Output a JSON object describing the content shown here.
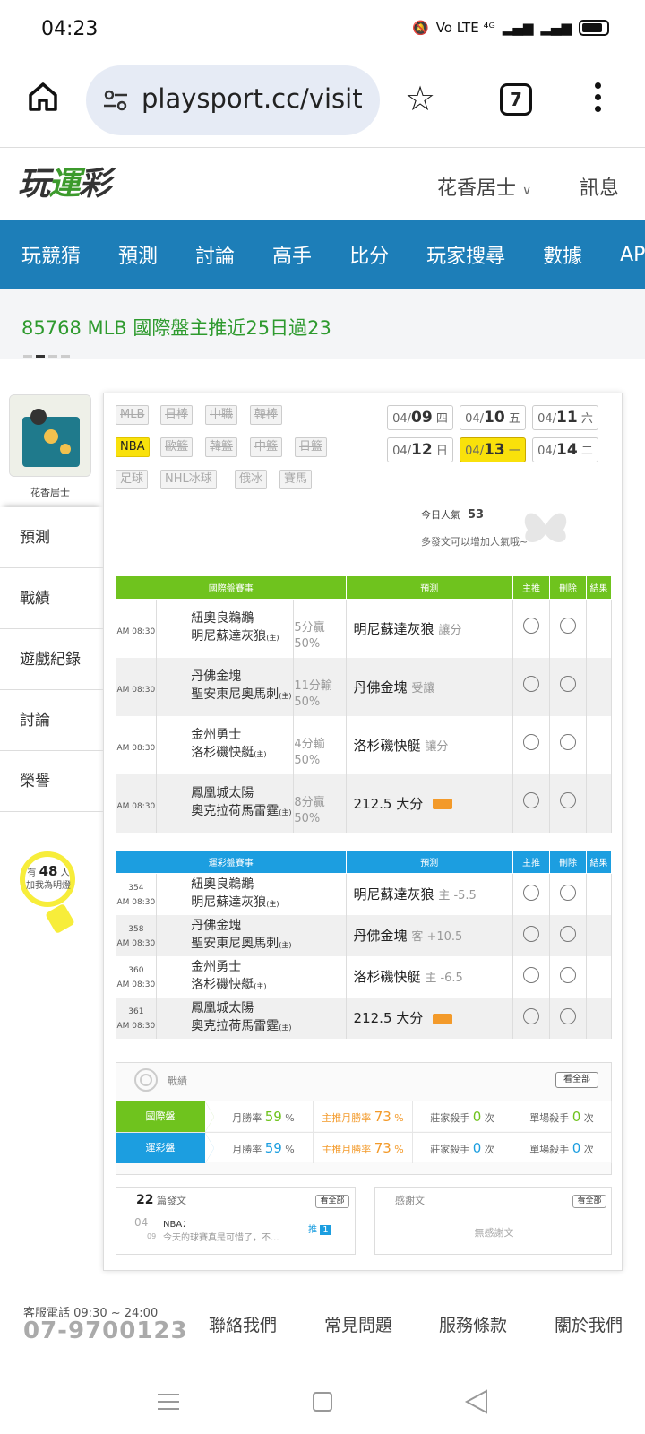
{
  "status_bar": {
    "time": "04:23",
    "icons_text": "Vo LTE ⁴ᴳ"
  },
  "browser": {
    "url": "playsport.cc/visit",
    "tab_count": "7"
  },
  "header": {
    "logo": "玩運彩",
    "user": "花香居士",
    "message": "訊息"
  },
  "nav": [
    "玩競猜",
    "預測",
    "討論",
    "高手",
    "比分",
    "玩家搜尋",
    "數據",
    "APP"
  ],
  "headline": "85768 MLB 國際盤主推近25日過23",
  "profile": {
    "name": "花香居士"
  },
  "sidebar": [
    {
      "label": "預測"
    },
    {
      "label": "戰績"
    },
    {
      "label": "遊戲紀錄"
    },
    {
      "label": "討論"
    },
    {
      "label": "榮譽"
    }
  ],
  "bulb": {
    "prefix": "有",
    "count": "48",
    "suffix": "人",
    "text": "加我為明燈"
  },
  "league_tags": [
    [
      "MLB",
      "日棒",
      "中職",
      "韓棒"
    ],
    [
      "NBA",
      "歐籃",
      "韓籃",
      "中籃",
      "日籃"
    ],
    [
      "足球",
      "NHL冰球",
      "俄冰",
      "賽馬"
    ]
  ],
  "active_league": "NBA",
  "dates": [
    {
      "d": "04/",
      "n": "09",
      "w": "四"
    },
    {
      "d": "04/",
      "n": "10",
      "w": "五"
    },
    {
      "d": "04/",
      "n": "11",
      "w": "六"
    },
    {
      "d": "04/",
      "n": "12",
      "w": "日"
    },
    {
      "d": "04/",
      "n": "13",
      "w": "一"
    },
    {
      "d": "04/",
      "n": "14",
      "w": "二"
    }
  ],
  "active_date": "04/13",
  "popularity": {
    "label": "今日人氣",
    "value": "53",
    "hint": "多發文可以增加人氣哦~"
  },
  "intl_table": {
    "headers": [
      "國際盤賽事",
      "預測",
      "主推",
      "刪除",
      "結果"
    ],
    "rows": [
      {
        "time": "AM 08:30",
        "away": "紐奧良鵜鶘",
        "home": "明尼蘇達灰狼",
        "home_mark": "(主)",
        "line": "5分贏",
        "pct": "50%",
        "pick": "明尼蘇達灰狼",
        "pick_note": "讓分",
        "badge": false
      },
      {
        "time": "AM 08:30",
        "away": "丹佛金塊",
        "home": "聖安東尼奧馬刺",
        "home_mark": "(主)",
        "line": "11分輸",
        "pct": "50%",
        "pick": "丹佛金塊",
        "pick_note": "受讓",
        "badge": false
      },
      {
        "time": "AM 08:30",
        "away": "金州勇士",
        "home": "洛杉磯快艇",
        "home_mark": "(主)",
        "line": "4分輸",
        "pct": "50%",
        "pick": "洛杉磯快艇",
        "pick_note": "讓分",
        "badge": false
      },
      {
        "time": "AM 08:30",
        "away": "鳳凰城太陽",
        "home": "奧克拉荷馬雷霆",
        "home_mark": "(主)",
        "line": "8分贏",
        "pct": "50%",
        "pick": "212.5 大分",
        "pick_note": "",
        "badge": true
      }
    ]
  },
  "lottery_table": {
    "headers": [
      "運彩盤賽事",
      "預測",
      "主推",
      "刪除",
      "結果"
    ],
    "rows": [
      {
        "num": "354",
        "time": "AM 08:30",
        "away": "紐奧良鵜鶘",
        "home": "明尼蘇達灰狼",
        "home_mark": "(主)",
        "pick": "明尼蘇達灰狼",
        "pick_note": "主 -5.5",
        "badge": false
      },
      {
        "num": "358",
        "time": "AM 08:30",
        "away": "丹佛金塊",
        "home": "聖安東尼奧馬刺",
        "home_mark": "(主)",
        "pick": "丹佛金塊",
        "pick_note": "客 +10.5",
        "badge": false
      },
      {
        "num": "360",
        "time": "AM 08:30",
        "away": "金州勇士",
        "home": "洛杉磯快艇",
        "home_mark": "(主)",
        "pick": "洛杉磯快艇",
        "pick_note": "主 -6.5",
        "badge": false
      },
      {
        "num": "361",
        "time": "AM 08:30",
        "away": "鳳凰城太陽",
        "home": "奧克拉荷馬雷霆",
        "home_mark": "(主)",
        "pick": "212.5 大分",
        "pick_note": "",
        "badge": true
      }
    ]
  },
  "record": {
    "title": "戰績",
    "see_all": "看全部",
    "rows": [
      {
        "label": "國際盤",
        "color": "#6fc31e",
        "win_label": "月勝率",
        "win": "59",
        "main_label": "主推月勝率",
        "main": "73",
        "pct": "%",
        "banker_label": "莊家殺手",
        "banker": "0",
        "single_label": "單場殺手",
        "single": "0",
        "unit": "次"
      },
      {
        "label": "運彩盤",
        "color": "#1c9ee0",
        "win_label": "月勝率",
        "win": "59",
        "main_label": "主推月勝率",
        "main": "73",
        "pct": "%",
        "banker_label": "莊家殺手",
        "banker": "0",
        "single_label": "單場殺手",
        "single": "0",
        "unit": "次"
      }
    ]
  },
  "posts": {
    "count": "22",
    "label": "篇發文",
    "see_all": "看全部",
    "date_top": "04",
    "date_bot": "09",
    "tag": "NBA：",
    "snippet": "今天的球賽真是可惜了，不...",
    "push": "推",
    "push_count": "1"
  },
  "thanks": {
    "label": "感謝文",
    "see_all": "看全部",
    "empty": "無感謝文"
  },
  "footer": {
    "tel_label": "客服電話 09:30 ~ 24:00",
    "tel": "07-9700123",
    "links": [
      "聯絡我們",
      "常見問題",
      "服務條款",
      "關於我們"
    ]
  }
}
